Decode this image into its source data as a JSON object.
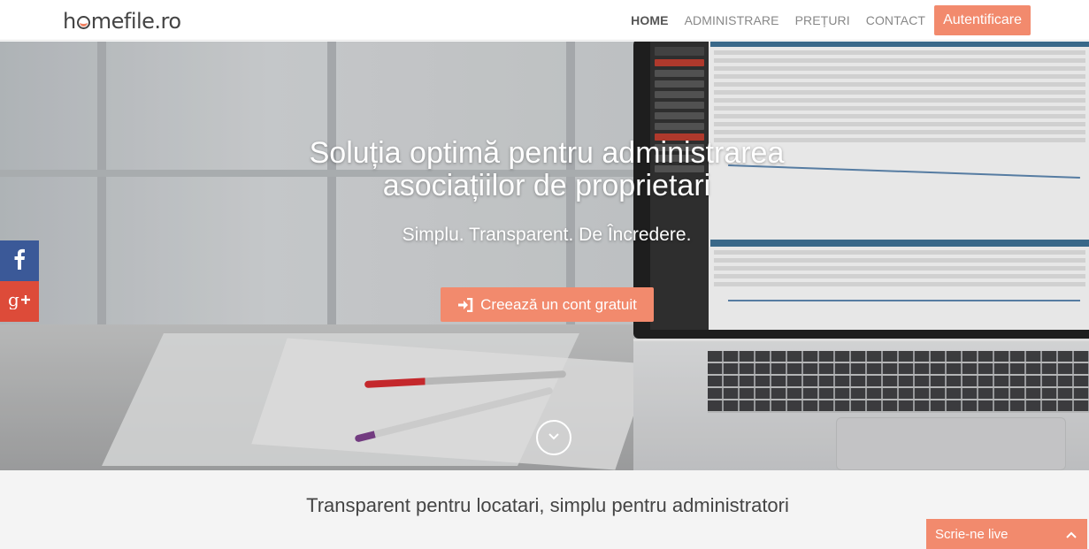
{
  "brand": {
    "logo_text_pre": "h",
    "logo_text_post": "mefile.ro"
  },
  "nav": {
    "items": [
      {
        "label": "HOME"
      },
      {
        "label": "ADMINISTRARE"
      },
      {
        "label": "PREȚURI"
      },
      {
        "label": "CONTACT"
      }
    ],
    "auth_label": "Autentificare"
  },
  "hero": {
    "title_line1": "Soluția optimă pentru administrarea",
    "title_line2": "asociațiilor de proprietari",
    "subtitle": "Simplu. Transparent. De Încredere.",
    "cta_label": "Creează un cont gratuit"
  },
  "social": {
    "facebook": "facebook-icon",
    "googleplus": "google-plus-icon"
  },
  "section": {
    "title": "Transparent pentru locatari, simplu pentru administratori"
  },
  "chat": {
    "label": "Scrie-ne live"
  },
  "colors": {
    "accent": "#f28a6d",
    "facebook": "#3b5998",
    "googleplus": "#dd4b39"
  }
}
